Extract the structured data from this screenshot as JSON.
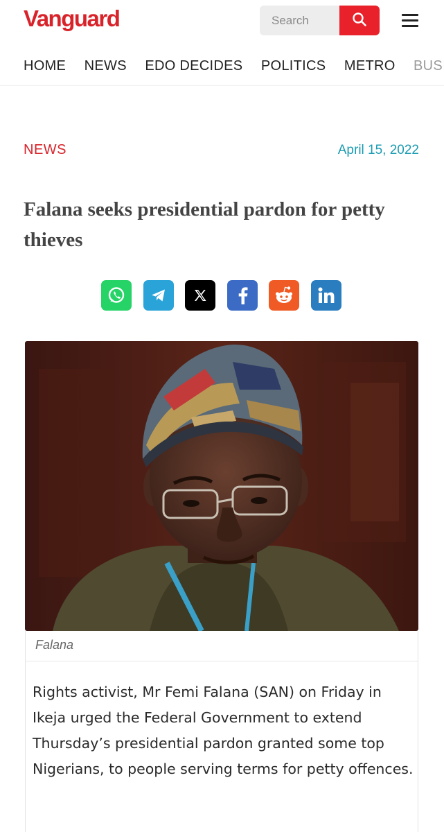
{
  "brand": {
    "name": "Vanguard",
    "color": "#d8232a"
  },
  "search": {
    "placeholder": "Search",
    "icon": "search-icon"
  },
  "menu": {
    "icon": "hamburger-menu-icon"
  },
  "nav": {
    "items": [
      "HOME",
      "NEWS",
      "EDO DECIDES",
      "POLITICS",
      "METRO",
      "BUSIN"
    ]
  },
  "article": {
    "category": "NEWS",
    "date": "April 15, 2022",
    "title": "Falana seeks presidential pardon for petty thieves",
    "share": [
      {
        "name": "whatsapp-icon",
        "color": "#25d366"
      },
      {
        "name": "telegram-icon",
        "color": "#2aa3d9"
      },
      {
        "name": "x-icon",
        "color": "#000000"
      },
      {
        "name": "facebook-icon",
        "color": "#3b6bc4"
      },
      {
        "name": "reddit-icon",
        "color": "#f05a24"
      },
      {
        "name": "linkedin-icon",
        "color": "#2a7dbf"
      }
    ],
    "image_caption": "Falana",
    "body": "Rights activist, Mr Femi Falana (SAN) on Friday in Ikeja urged the Federal Government to extend Thursday’s presidential pardon granted some top Nigerians, to people serving terms for petty offences."
  }
}
